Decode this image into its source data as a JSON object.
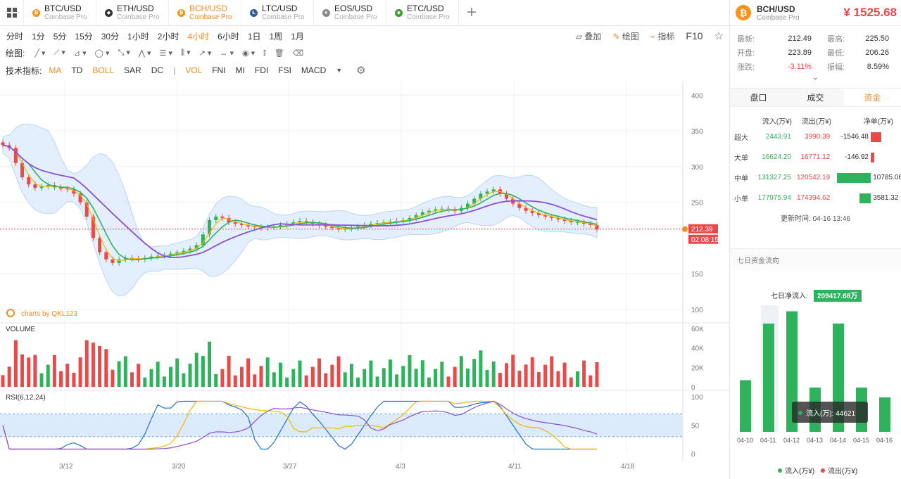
{
  "tabs": [
    {
      "pair": "BTC/USD",
      "exch": "Coinbase Pro",
      "color": "#f7931a",
      "sym": "₿",
      "active": false
    },
    {
      "pair": "ETH/USD",
      "exch": "Coinbase Pro",
      "color": "#333333",
      "sym": "◆",
      "active": false
    },
    {
      "pair": "BCH/USD",
      "exch": "Coinbase Pro",
      "color": "#f7931a",
      "sym": "₿",
      "active": true
    },
    {
      "pair": "LTC/USD",
      "exch": "Coinbase Pro",
      "color": "#345d9d",
      "sym": "Ł",
      "active": false
    },
    {
      "pair": "EOS/USD",
      "exch": "Coinbase Pro",
      "color": "#888888",
      "sym": "e",
      "active": false
    },
    {
      "pair": "ETC/USD",
      "exch": "Coinbase Pro",
      "color": "#33a02c",
      "sym": "◆",
      "active": false
    }
  ],
  "intervals": [
    "分时",
    "1分",
    "5分",
    "15分",
    "30分",
    "1小时",
    "2小时",
    "4小时",
    "6小时",
    "1日",
    "1周",
    "1月"
  ],
  "active_interval": "4小时",
  "tools": {
    "overlay": "叠加",
    "draw": "绘图",
    "indicator": "指标",
    "f10": "F10"
  },
  "draw_label": "绘图:",
  "indicator_label": "技术指标:",
  "indicators": [
    {
      "name": "MA",
      "on": true
    },
    {
      "name": "TD",
      "on": false
    },
    {
      "name": "BOLL",
      "on": true
    },
    {
      "name": "SAR",
      "on": false
    },
    {
      "name": "DC",
      "on": false
    },
    {
      "name": "|",
      "sep": true
    },
    {
      "name": "VOL",
      "on": true
    },
    {
      "name": "FNI",
      "on": false
    },
    {
      "name": "MI",
      "on": false
    },
    {
      "name": "FDI",
      "on": false
    },
    {
      "name": "FSI",
      "on": false
    },
    {
      "name": "MACD",
      "on": false
    }
  ],
  "header": {
    "pair": "BCH/USD",
    "exch": "Coinbase Pro",
    "price": "¥ 1525.68"
  },
  "stats": [
    {
      "k": "最新:",
      "v": "212.49",
      "k2": "最高:",
      "v2": "225.50",
      "vclass": "",
      "v2class": ""
    },
    {
      "k": "开盘:",
      "v": "223.89",
      "k2": "最低:",
      "v2": "206.26",
      "vclass": "",
      "v2class": ""
    },
    {
      "k": "涨跌:",
      "v": "-3.11%",
      "k2": "振幅:",
      "v2": "8.59%",
      "vclass": "red",
      "v2class": ""
    }
  ],
  "panel_tabs": [
    "盘口",
    "成交",
    "资金"
  ],
  "active_panel_tab": "资金",
  "fund_headers": [
    "流入(万¥)",
    "流出(万¥)",
    "净单(万¥)"
  ],
  "fund_rows": [
    {
      "label": "超大",
      "in": "2443.91",
      "out": "3990.39",
      "net": "-1546.48",
      "netv": -1546.48
    },
    {
      "label": "大单",
      "in": "16624.20",
      "out": "16771.12",
      "net": "-146.92",
      "netv": -146.92
    },
    {
      "label": "中单",
      "in": "131327.25",
      "out": "120542.19",
      "net": "10785.06",
      "netv": 10785.06
    },
    {
      "label": "小单",
      "in": "177975.94",
      "out": "174394.62",
      "net": "3581.32",
      "netv": 3581.32
    }
  ],
  "update_time": "更新时间: 04-16 13:46",
  "weekly": {
    "title": "七日资金流向",
    "net_label": "七日净流入:",
    "net_value": "209417.68万",
    "days": [
      "04-10",
      "04-11",
      "04-12",
      "04-13",
      "04-14",
      "04-15",
      "04-16"
    ],
    "values": [
      42000,
      88000,
      98000,
      36000,
      88000,
      36000,
      28000
    ],
    "tooltip": "流入(万): 44621",
    "legend_in": "流入(万¥)",
    "legend_out": "流出(万¥)"
  },
  "chart_data": {
    "type": "candlestick",
    "interval": "4小时",
    "price_axis": [
      400,
      350,
      300,
      250,
      150,
      100
    ],
    "volume_axis": [
      "60K",
      "40K",
      "20K",
      "0"
    ],
    "rsi_axis": [
      100,
      50,
      0
    ],
    "x_ticks": [
      "3/12",
      "3/20",
      "3/27",
      "4/3",
      "4/11",
      "4/18"
    ],
    "current_price": "212.39",
    "countdown": "02:08:15",
    "watermark": "charts by QKL123",
    "volume_label": "VOLUME",
    "rsi_label": "RSI(6,12,24)",
    "close_series": [
      330,
      326,
      305,
      285,
      275,
      270,
      272,
      274,
      271,
      269,
      268,
      262,
      250,
      230,
      200,
      180,
      170,
      165,
      170,
      172,
      171,
      170,
      172,
      174,
      175,
      176,
      178,
      180,
      182,
      185,
      190,
      205,
      225,
      230,
      228,
      222,
      220,
      218,
      216,
      215,
      214,
      215,
      216,
      218,
      220,
      222,
      224,
      222,
      220,
      218,
      216,
      214,
      212,
      213,
      214,
      216,
      218,
      220,
      221,
      222,
      223,
      224,
      225,
      228,
      232,
      236,
      238,
      240,
      241,
      240,
      238,
      242,
      248,
      255,
      262,
      265,
      268,
      262,
      255,
      248,
      242,
      238,
      235,
      232,
      230,
      228,
      226,
      224,
      222,
      222,
      220,
      218,
      212
    ]
  }
}
